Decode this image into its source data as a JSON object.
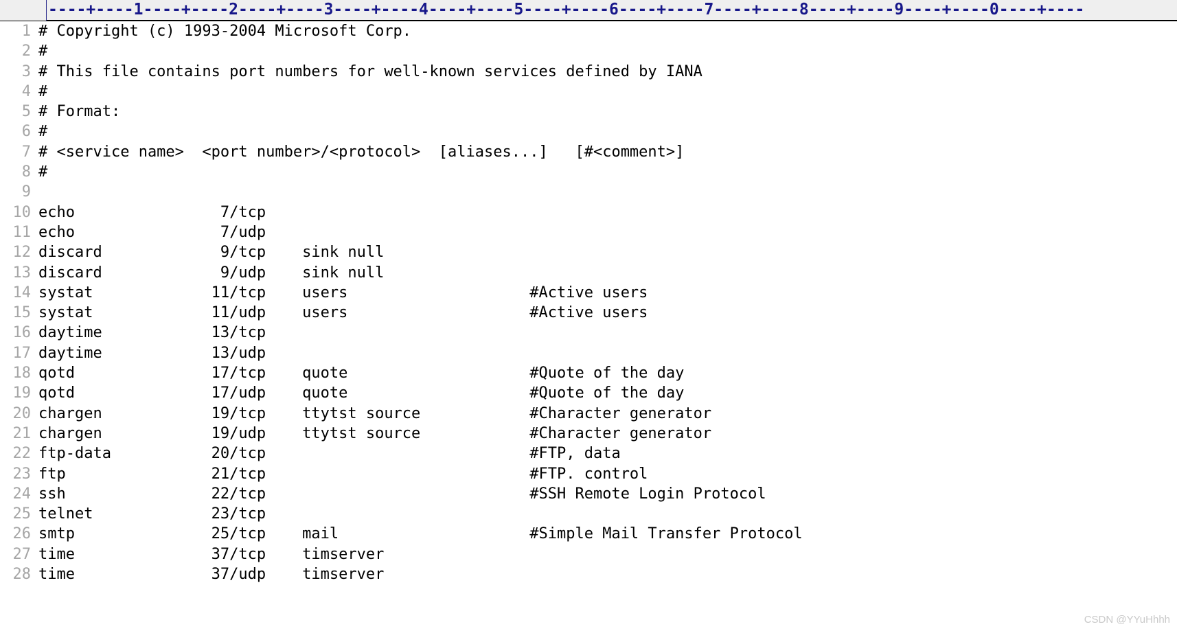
{
  "ruler": {
    "text": "----+----1----+----2----+----3----+----4----+----5----+----6----+----7----+----8----+----9----+----0----+----",
    "tick_color": "#17178a",
    "background": "#efefef"
  },
  "editor": {
    "background": "#ffffff",
    "text_color": "#000000",
    "line_number_color": "#a6a6a6",
    "lines": [
      {
        "number": "1",
        "text": "# Copyright (c) 1993-2004 Microsoft Corp."
      },
      {
        "number": "2",
        "text": "#"
      },
      {
        "number": "3",
        "text": "# This file contains port numbers for well-known services defined by IANA"
      },
      {
        "number": "4",
        "text": "#"
      },
      {
        "number": "5",
        "text": "# Format:"
      },
      {
        "number": "6",
        "text": "#"
      },
      {
        "number": "7",
        "text": "# <service name>  <port number>/<protocol>  [aliases...]   [#<comment>]"
      },
      {
        "number": "8",
        "text": "#"
      },
      {
        "number": "9",
        "text": ""
      },
      {
        "number": "10",
        "text": "echo                7/tcp"
      },
      {
        "number": "11",
        "text": "echo                7/udp"
      },
      {
        "number": "12",
        "text": "discard             9/tcp    sink null"
      },
      {
        "number": "13",
        "text": "discard             9/udp    sink null"
      },
      {
        "number": "14",
        "text": "systat             11/tcp    users                    #Active users"
      },
      {
        "number": "15",
        "text": "systat             11/udp    users                    #Active users"
      },
      {
        "number": "16",
        "text": "daytime            13/tcp"
      },
      {
        "number": "17",
        "text": "daytime            13/udp"
      },
      {
        "number": "18",
        "text": "qotd               17/tcp    quote                    #Quote of the day"
      },
      {
        "number": "19",
        "text": "qotd               17/udp    quote                    #Quote of the day"
      },
      {
        "number": "20",
        "text": "chargen            19/tcp    ttytst source            #Character generator"
      },
      {
        "number": "21",
        "text": "chargen            19/udp    ttytst source            #Character generator"
      },
      {
        "number": "22",
        "text": "ftp-data           20/tcp                             #FTP, data"
      },
      {
        "number": "23",
        "text": "ftp                21/tcp                             #FTP. control"
      },
      {
        "number": "24",
        "text": "ssh                22/tcp                             #SSH Remote Login Protocol"
      },
      {
        "number": "25",
        "text": "telnet             23/tcp"
      },
      {
        "number": "26",
        "text": "smtp               25/tcp    mail                     #Simple Mail Transfer Protocol"
      },
      {
        "number": "27",
        "text": "time               37/tcp    timserver"
      },
      {
        "number": "28",
        "text": "time               37/udp    timserver"
      }
    ]
  },
  "watermark": {
    "text": "CSDN @YYuHhhh"
  }
}
